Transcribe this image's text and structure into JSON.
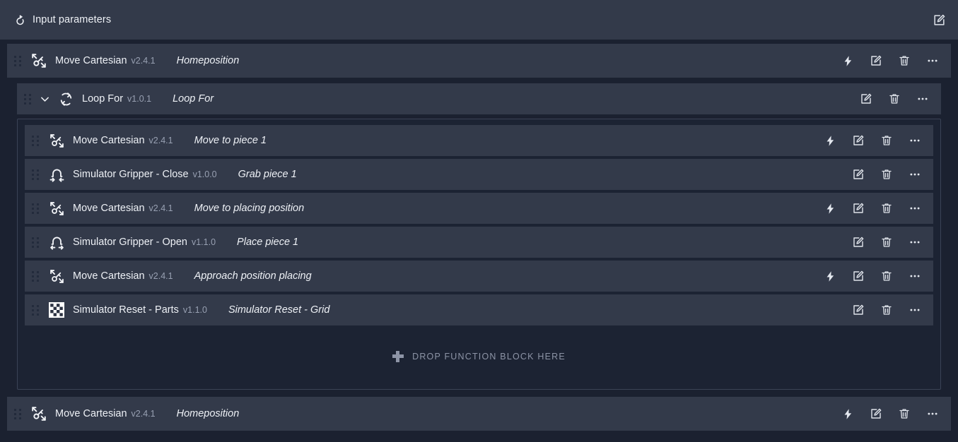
{
  "header": {
    "icon": "power-reset-icon",
    "title": "Input parameters",
    "edit_action": "edit-icon"
  },
  "dropzone": {
    "icon": "plus-icon",
    "label": "DROP FUNCTION BLOCK HERE"
  },
  "colors": {
    "page_background": "#1b2130",
    "row_background": "#333a4a",
    "nested_container_background": "#1c2333",
    "nested_container_border": "#3b4356",
    "text_primary": "#eef1f6",
    "text_muted": "#98a0b2",
    "icon": "#dfe3ea"
  },
  "actions": {
    "run": "lightning-icon",
    "edit": "edit-icon",
    "delete": "trash-icon",
    "more": "more-icon"
  },
  "program": {
    "top_before": {
      "icon": "move-cartesian-icon",
      "name": "Move Cartesian",
      "version": "v2.4.1",
      "label": "Homeposition",
      "has_run": true
    },
    "loop": {
      "icon": "loop-icon",
      "chevron": "chevron-down-icon",
      "name": "Loop For",
      "version": "v1.0.1",
      "label": "Loop For",
      "has_run": false,
      "expanded": true,
      "children": [
        {
          "icon": "move-cartesian-icon",
          "name": "Move Cartesian",
          "version": "v2.4.1",
          "label": "Move to piece 1",
          "has_run": true
        },
        {
          "icon": "gripper-close-icon",
          "name": "Simulator Gripper - Close",
          "version": "v1.0.0",
          "label": "Grab piece 1",
          "has_run": false
        },
        {
          "icon": "move-cartesian-icon",
          "name": "Move Cartesian",
          "version": "v2.4.1",
          "label": "Move to placing position",
          "has_run": true
        },
        {
          "icon": "gripper-open-icon",
          "name": "Simulator Gripper - Open",
          "version": "v1.1.0",
          "label": "Place piece 1",
          "has_run": false
        },
        {
          "icon": "move-cartesian-icon",
          "name": "Move Cartesian",
          "version": "v2.4.1",
          "label": "Approach position placing",
          "has_run": true
        },
        {
          "icon": "checkerboard-icon",
          "name": "Simulator Reset - Parts",
          "version": "v1.1.0",
          "label": "Simulator Reset - Grid",
          "has_run": false
        }
      ]
    },
    "top_after": {
      "icon": "move-cartesian-icon",
      "name": "Move Cartesian",
      "version": "v2.4.1",
      "label": "Homeposition",
      "has_run": true
    }
  }
}
